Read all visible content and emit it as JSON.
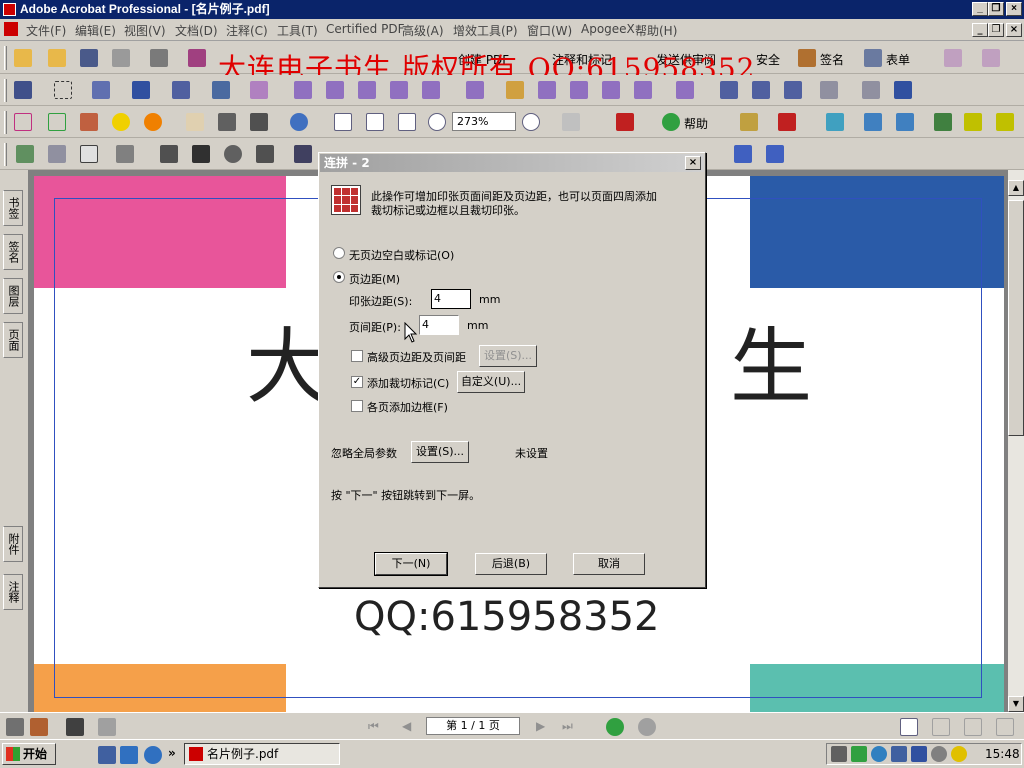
{
  "window": {
    "title": "Adobe Acrobat Professional - [名片例子.pdf]"
  },
  "menu": [
    "文件(F)",
    "编辑(E)",
    "视图(V)",
    "文档(D)",
    "注释(C)",
    "工具(T)",
    "Certified PDF",
    "高级(A)",
    "增效工具(P)",
    "窗口(W)",
    "ApogeeX",
    "帮助(H)"
  ],
  "watermark": "大连电子书生 版权所有 QQ:615958352",
  "toolbar": {
    "create_pdf": "创建 PDF",
    "comment_markup": "注释和标记",
    "send_review": "发送供审阅",
    "security": "安全",
    "sign": "签名",
    "forms": "表单",
    "zoom": "273%",
    "help": "帮助"
  },
  "side_tabs": [
    "书签",
    "签名",
    "图层",
    "页面",
    "附件",
    "注释"
  ],
  "document": {
    "big_text_left": "大",
    "big_text_right": "生",
    "qq": "QQ:615958352",
    "colors": {
      "pink": "#e8559a",
      "blue": "#2a5ba8",
      "orange": "#f5a04a",
      "teal": "#5bbfaf"
    }
  },
  "dialog": {
    "title": "连拼 - 2",
    "description_line1": "此操作可增加印张页面间距及页边距，也可以页面四周添加",
    "description_line2": "裁切标记或边框以且裁切印张。",
    "radio_none": "无页边空白或标记(O)",
    "radio_margin": "页边距(M)",
    "sheet_margin_label": "印张边距(S):",
    "sheet_margin_value": "4",
    "page_gap_label": "页间距(P):",
    "page_gap_value": "4",
    "unit": "mm",
    "chk_advanced": "高级页边距及页间距",
    "btn_advanced_settings": "设置(S)...",
    "chk_crop": "添加裁切标记(C)",
    "btn_custom": "自定义(U)...",
    "chk_border": "各页添加边框(F)",
    "global_label": "忽略全局参数",
    "btn_global_settings": "设置(S)...",
    "global_status": "未设置",
    "hint": "按 \"下一\" 按钮跳转到下一屏。",
    "btn_next": "下一(N)",
    "btn_back": "后退(B)",
    "btn_cancel": "取消"
  },
  "status": {
    "page": "第 1 / 1 页"
  },
  "taskbar": {
    "start": "开始",
    "item": "名片例子.pdf",
    "time": "15:48"
  }
}
